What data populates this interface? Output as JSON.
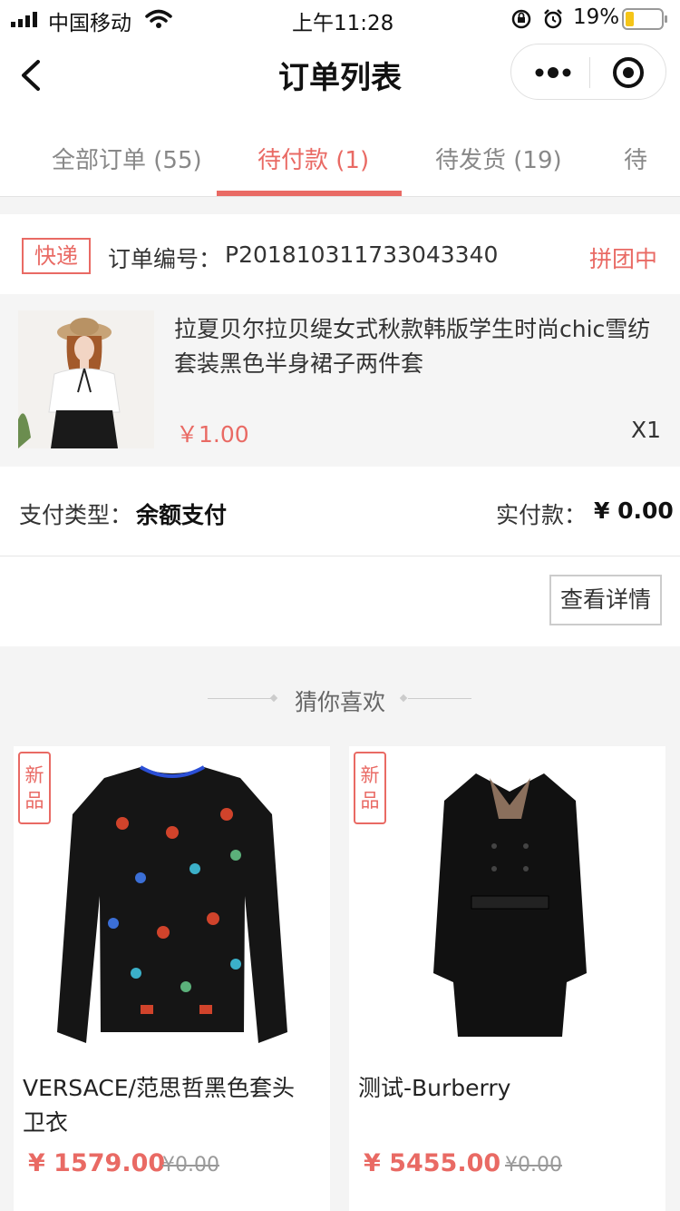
{
  "status_bar": {
    "carrier": "中国移动",
    "time": "上午11:28",
    "battery": "19%",
    "icons": [
      "signal-icon",
      "wifi-icon",
      "rotation-lock-icon",
      "alarm-icon",
      "battery-icon"
    ]
  },
  "nav": {
    "title": "订单列表",
    "back_icon": "chevron-left-icon",
    "more_icon": "more-dots-icon",
    "close_icon": "target-circle-icon"
  },
  "tabs": [
    {
      "label": "全部订单 (55)",
      "active": false
    },
    {
      "label": "待付款 (1)",
      "active": true
    },
    {
      "label": "待发货 (19)",
      "active": false
    },
    {
      "label": "待",
      "active": false
    }
  ],
  "colors": {
    "accent": "#e96a64",
    "muted": "#888888",
    "border": "#e3e3e3"
  },
  "order": {
    "tag": "快递",
    "number_label": "订单编号：",
    "number": "P201810311733043340",
    "status": "拼团中",
    "item": {
      "title": "拉夏贝尔拉贝缇女式秋款韩版学生时尚chic雪纺套装黑色半身裙子两件套",
      "price": "￥1.00",
      "qty": "X1"
    },
    "pay_type_label": "支付类型：",
    "pay_type": "余额支付",
    "paid_label": "实付款：",
    "paid_amount": "¥ 0.00",
    "detail_button": "查看详情"
  },
  "recommend": {
    "title": "猜你喜欢",
    "products": [
      {
        "badge": "新品",
        "name": "VERSACE/范思哲黑色套头卫衣",
        "price": "¥ 1579.00",
        "original_price": "¥0.00"
      },
      {
        "badge": "新品",
        "name": "测试-Burberry",
        "price": "¥ 5455.00",
        "original_price": "¥0.00"
      }
    ]
  }
}
